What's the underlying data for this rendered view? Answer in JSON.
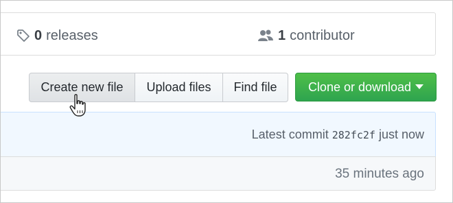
{
  "summary": {
    "releases": {
      "count": "0",
      "label": "releases",
      "icon": "tag-icon"
    },
    "contributors": {
      "count": "1",
      "label": "contributor",
      "icon": "people-icon"
    }
  },
  "toolbar": {
    "create_label": "Create new file",
    "upload_label": "Upload files",
    "find_label": "Find file",
    "clone_label": "Clone or download",
    "clone_color": "#2ea44f"
  },
  "commit": {
    "prefix": "Latest commit",
    "sha": "282fc2f",
    "suffix": "just now"
  },
  "file_row": {
    "time": "35 minutes ago"
  },
  "cursor": {
    "icon": "hand-pointer-icon"
  }
}
